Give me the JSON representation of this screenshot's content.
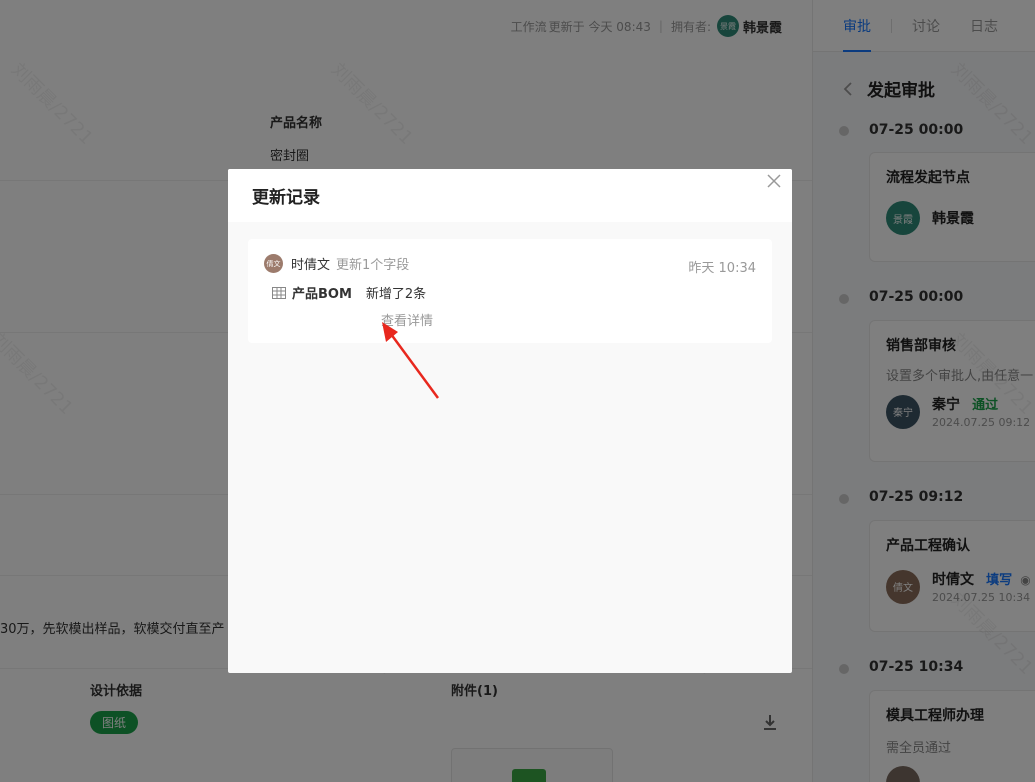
{
  "topbar": {
    "workflow_label": "工作流",
    "updated_text": "更新于 今天 08:43",
    "owner_label": "拥有者:",
    "owner_avatar": "景霞",
    "owner_name": "韩景霞"
  },
  "main": {
    "product_name_label": "产品名称",
    "product_name_value": "密封圈",
    "notes_text": "30万，先软模出样品，软模交付直至产",
    "design_basis_label": "设计依据",
    "design_basis_tag": "图纸",
    "attachments_label": "附件(1)"
  },
  "right_panel": {
    "tabs": [
      {
        "label": "审批"
      },
      {
        "label": "讨论"
      },
      {
        "label": "日志"
      }
    ],
    "title": "发起审批",
    "timeline": [
      {
        "time": "07-25 00:00",
        "card_title": "流程发起节点",
        "sub": "",
        "avatar": "景霞",
        "avatar_color": "#2e8b78",
        "name": "韩景霞",
        "status": "",
        "status_color": "",
        "date": ""
      },
      {
        "time": "07-25 00:00",
        "card_title": "销售部审核",
        "sub": "设置多个审批人,由任意一",
        "avatar": "秦宁",
        "avatar_color": "#3d5564",
        "name": "秦宁",
        "status": "通过",
        "status_color": "#1aa34a",
        "date": "2024.07.25 09:12"
      },
      {
        "time": "07-25 09:12",
        "card_title": "产品工程确认",
        "sub": "",
        "avatar": "倩文",
        "avatar_color": "#8a6d5a",
        "name": "时倩文",
        "status": "填写",
        "status_color": "#1677ff",
        "date": "2024.07.25 10:34"
      },
      {
        "time": "07-25 10:34",
        "card_title": "模具工程师办理",
        "sub": "需全员通过",
        "avatar": "",
        "avatar_color": "#7a6a60",
        "name": "",
        "status": "",
        "status_color": "",
        "date": ""
      }
    ]
  },
  "modal": {
    "title": "更新记录",
    "record": {
      "avatar": "倩文",
      "user": "时倩文",
      "action": "更新1个字段",
      "time": "昨天 10:34",
      "field_name": "产品BOM",
      "change": "新增了2条",
      "link": "查看详情"
    }
  },
  "watermark": "刘雨晨/2721",
  "colors": {
    "accent": "#1677ff",
    "success": "#1aa34a",
    "arrow": "#e8281e"
  }
}
